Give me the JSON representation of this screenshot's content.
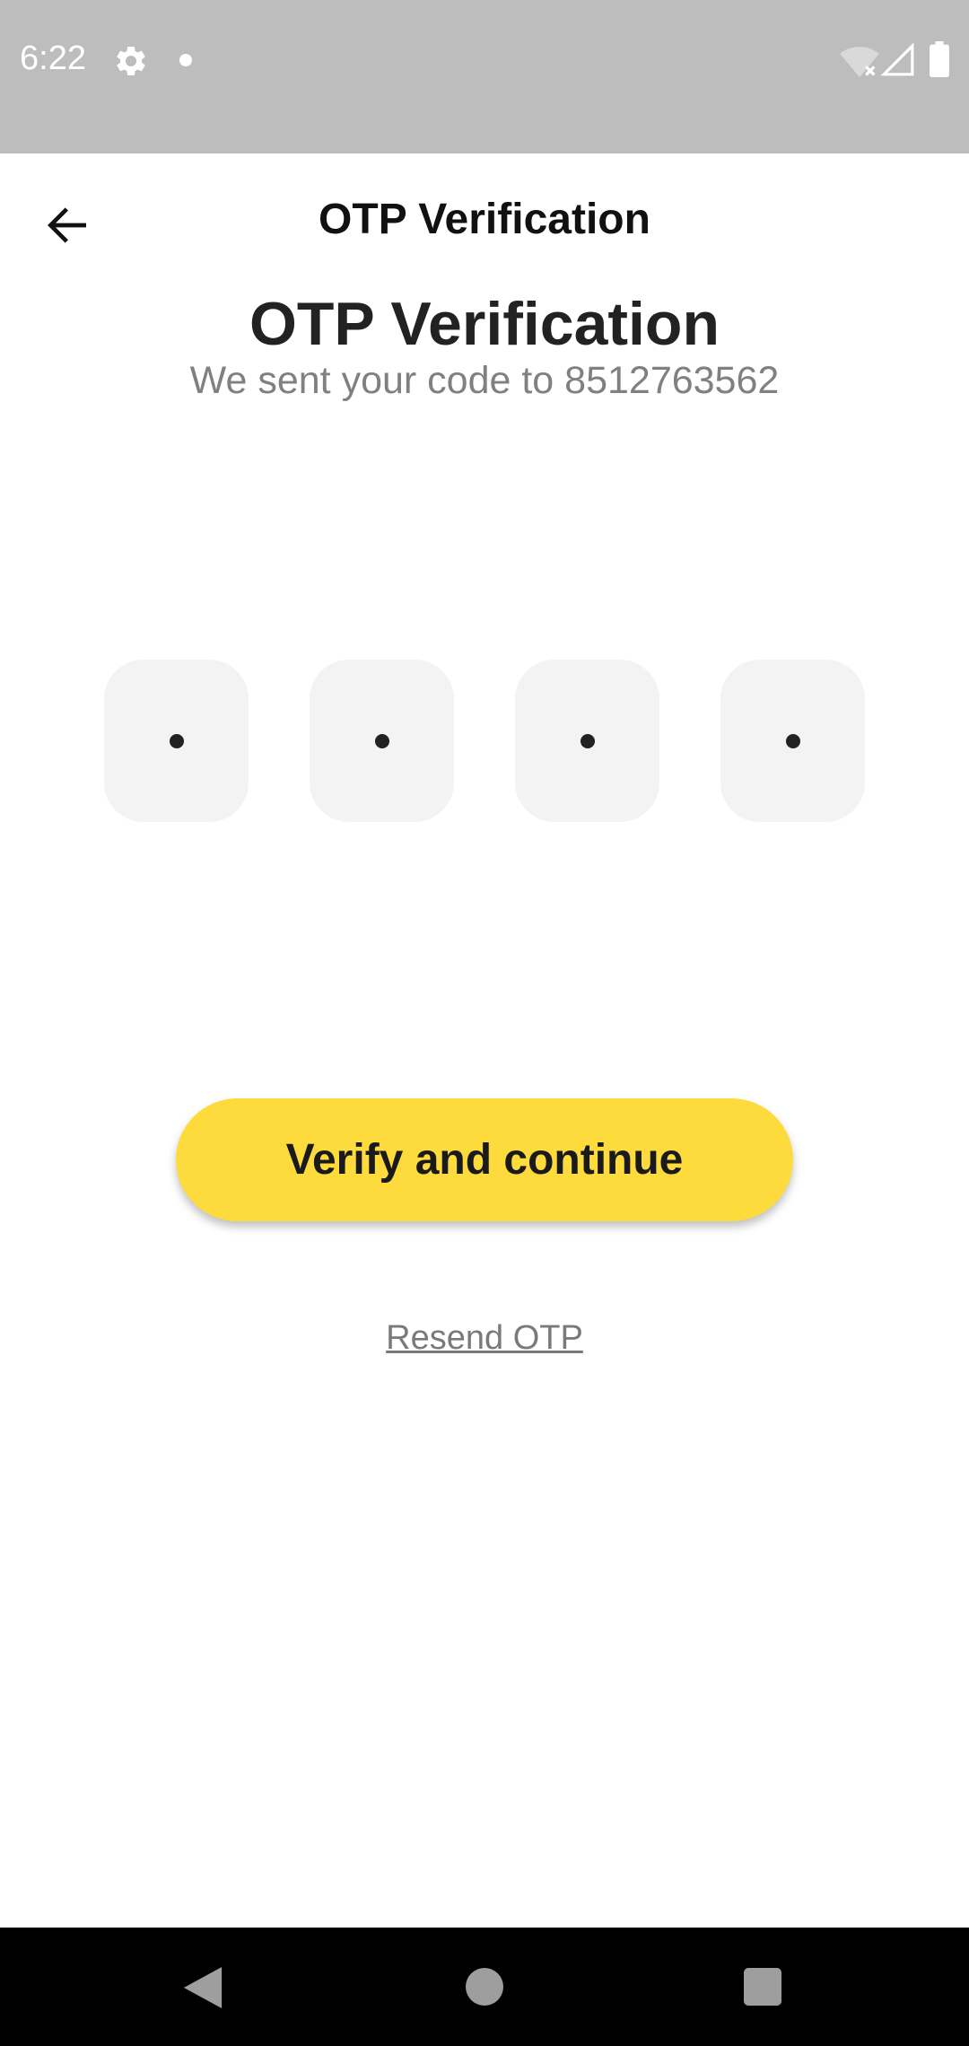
{
  "status_bar": {
    "time": "6:22",
    "icons": [
      "gear-icon",
      "notification-dot-icon",
      "wifi-off-icon",
      "signal-icon",
      "battery-icon"
    ]
  },
  "app_bar": {
    "title": "OTP Verification",
    "back_icon": "arrow-back-icon"
  },
  "main": {
    "heading": "OTP Verification",
    "subheading": "We sent your code to 8512763562",
    "otp_boxes": [
      "•",
      "•",
      "•",
      "•"
    ],
    "verify_label": "Verify and continue",
    "resend_label": "Resend OTP"
  },
  "nav_bar": {
    "icons": [
      "nav-back-icon",
      "nav-home-icon",
      "nav-recents-icon"
    ]
  },
  "colors": {
    "status_bar": "#bdbdbd",
    "accent_button": "#fedb3d",
    "otp_box_bg": "#f3f3f3",
    "nav_bar": "#000000"
  }
}
